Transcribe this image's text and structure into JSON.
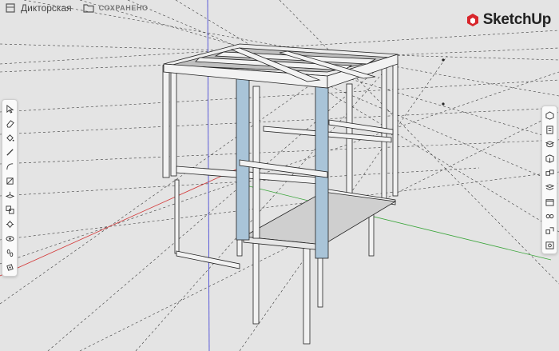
{
  "app": {
    "brand": "SketchUp"
  },
  "document": {
    "title": "Дикторская",
    "save_status": "СОХРАНЕНО"
  },
  "colors": {
    "accent": "#d8262c",
    "panel_blue": "#a9c4d8",
    "axis_red": "#d43a3a",
    "axis_green": "#3aa53a",
    "axis_blue": "#3a3ad4"
  },
  "left_toolbar": [
    {
      "icon": "select-arrow-icon"
    },
    {
      "icon": "eraser-icon"
    },
    {
      "icon": "paint-bucket-icon"
    },
    {
      "icon": "pencil-line-icon"
    },
    {
      "icon": "arc-icon"
    },
    {
      "icon": "rectangle-icon"
    },
    {
      "icon": "push-pull-icon"
    },
    {
      "icon": "move-icon"
    },
    {
      "icon": "tape-measure-icon"
    },
    {
      "icon": "orbit-icon"
    },
    {
      "icon": "footprints-icon"
    },
    {
      "icon": "section-plane-icon"
    }
  ],
  "right_toolbar": [
    {
      "icon": "entity-info-icon"
    },
    {
      "icon": "instructor-icon"
    },
    {
      "icon": "components-icon"
    },
    {
      "icon": "materials-icon"
    },
    {
      "icon": "styles-icon"
    },
    {
      "icon": "tags-icon"
    },
    {
      "icon": "scenes-icon"
    },
    {
      "icon": "display-glasses-icon"
    },
    {
      "icon": "solid-tools-icon"
    },
    {
      "icon": "model-info-icon"
    }
  ]
}
